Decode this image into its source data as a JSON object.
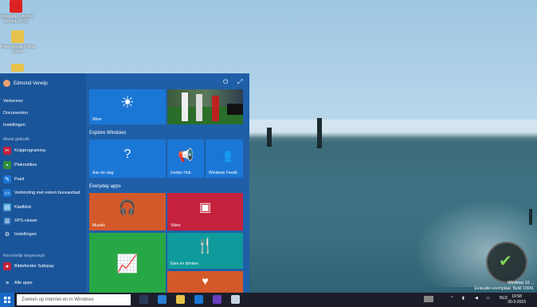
{
  "desktop": {
    "icons": [
      {
        "label": "Bitdefender Internet Security 2015"
      },
      {
        "label": "Power Media Player Centre"
      }
    ]
  },
  "start": {
    "user": "Edmond Verwijs",
    "links": [
      "Verkenner",
      "Documenten",
      "Instellingen"
    ],
    "most_used_title": "Meest gebruikt",
    "most_used": [
      "Knipprogramma",
      "Plaknotities",
      "Paint",
      "Verbinding met extern bureaublad",
      "Kladblok",
      "XPS-viewer",
      "Instellingen"
    ],
    "recent_title": "Recentelijk toegevoegd",
    "recent": [
      "Bitdefender Safepay"
    ],
    "all_apps": "Alle apps",
    "groups": {
      "explore": "Explore Windows",
      "everyday": "Everyday apps"
    },
    "tiles": {
      "weather": "Weer",
      "getstarted": "Aan de slag",
      "insider": "Insider Hub",
      "feedback": "Windows Feedb",
      "music": "Muziek",
      "video": "Video",
      "food": "Eten en drinken"
    },
    "icons": {
      "power": "power-icon",
      "expand": "expand-icon"
    }
  },
  "taskbar": {
    "search_placeholder": "Zoeken op internet en in Windows",
    "language": "NLD",
    "time": "10:58",
    "date": "30-3-2015"
  },
  "watermark": {
    "line1": "Windows 10 ...",
    "line2": "Evaluatie-exemplaar. Build 10041"
  },
  "colors": {
    "start_bg": "#1f5fa8",
    "tile_blue": "#1b77d6",
    "tile_orange": "#d4592a",
    "tile_red": "#c4223d",
    "tile_green": "#28a745",
    "tile_teal": "#0f9b9b"
  }
}
